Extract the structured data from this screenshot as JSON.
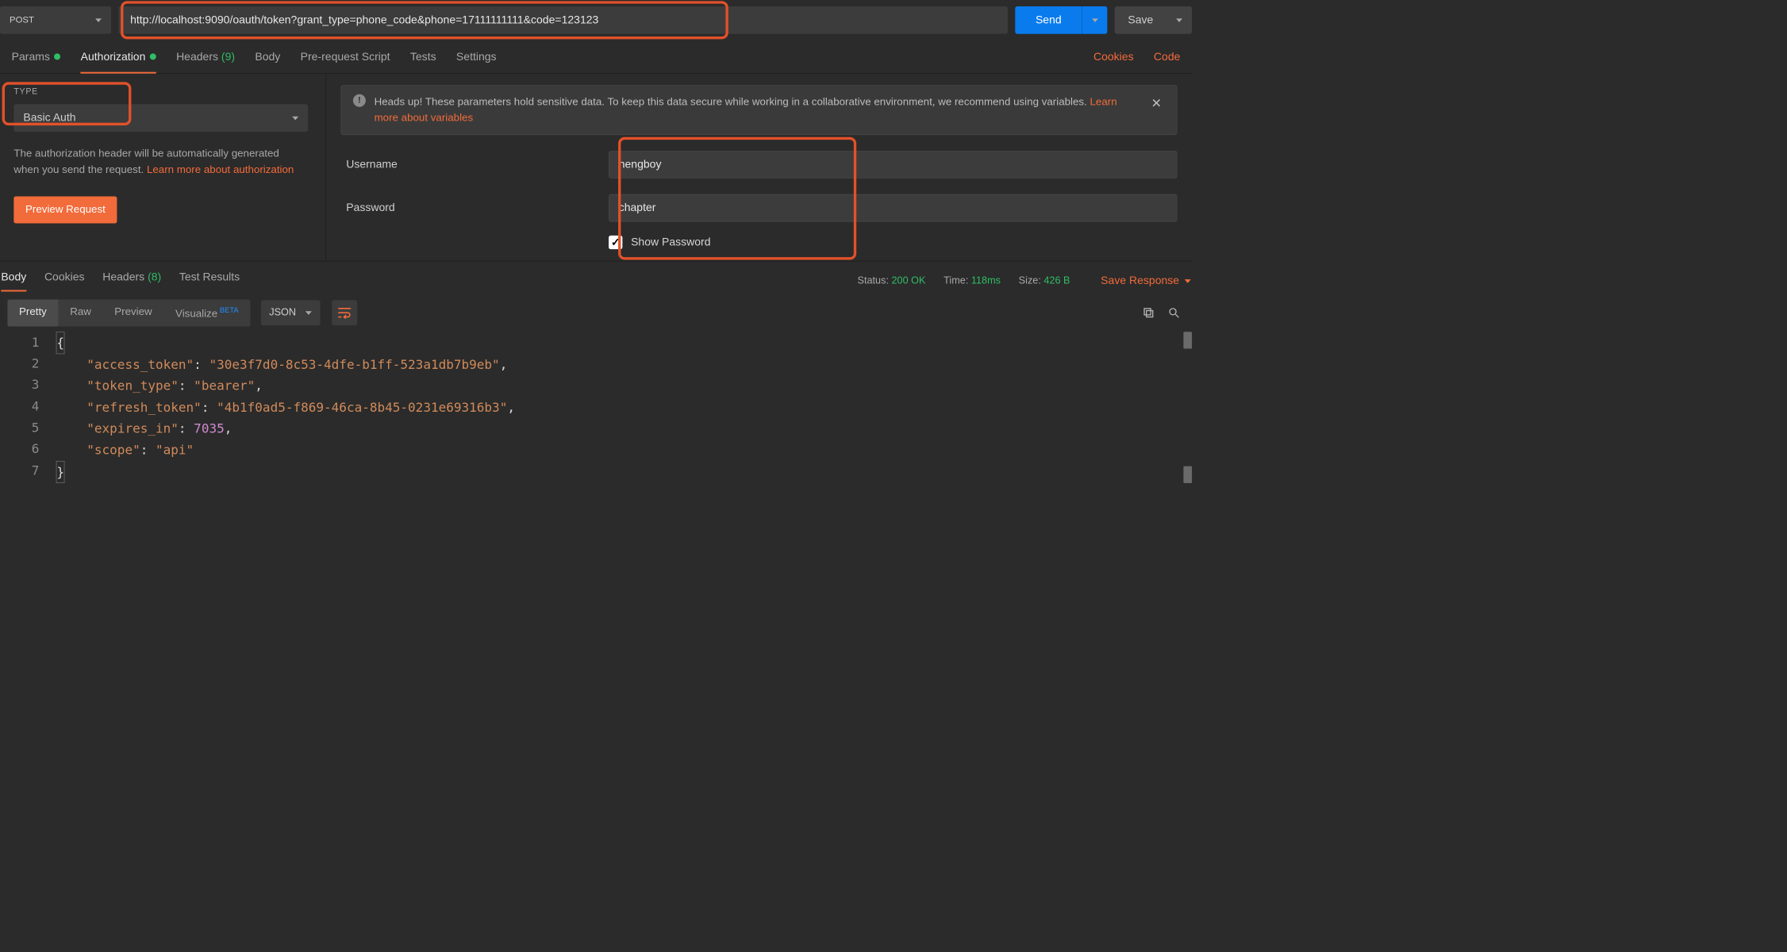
{
  "request": {
    "method": "POST",
    "url": "http://localhost:9090/oauth/token?grant_type=phone_code&phone=17111111111&code=123123",
    "send_label": "Send",
    "save_label": "Save"
  },
  "req_tabs": {
    "params": "Params",
    "authorization": "Authorization",
    "headers": "Headers",
    "headers_count": "(9)",
    "body": "Body",
    "prerequest": "Pre-request Script",
    "tests": "Tests",
    "settings": "Settings",
    "cookies": "Cookies",
    "code": "Code"
  },
  "auth": {
    "type_label": "TYPE",
    "type_value": "Basic Auth",
    "description_1": "The authorization header will be automatically generated when you send the request. ",
    "description_link": "Learn more about authorization",
    "preview_btn": "Preview Request",
    "banner_text": "Heads up! These parameters hold sensitive data. To keep this data secure while working in a collaborative environment, we recommend using variables. ",
    "banner_link": "Learn more about variables",
    "username_label": "Username",
    "username_value": "hengboy",
    "password_label": "Password",
    "password_value": "chapter",
    "show_password_label": "Show Password",
    "show_password_checked": true
  },
  "response": {
    "tabs": {
      "body": "Body",
      "cookies": "Cookies",
      "headers": "Headers",
      "headers_count": "(8)",
      "test_results": "Test Results"
    },
    "status_label": "Status:",
    "status_value": "200 OK",
    "time_label": "Time:",
    "time_value": "118ms",
    "size_label": "Size:",
    "size_value": "426 B",
    "save_response": "Save Response",
    "view": {
      "pretty": "Pretty",
      "raw": "Raw",
      "preview": "Preview",
      "visualize": "Visualize",
      "beta": "BETA",
      "format": "JSON"
    },
    "json": {
      "access_token": "30e3f7d0-8c53-4dfe-b1ff-523a1db7b9eb",
      "token_type": "bearer",
      "refresh_token": "4b1f0ad5-f869-46ca-8b45-0231e69316b3",
      "expires_in": 7035,
      "scope": "api"
    }
  }
}
